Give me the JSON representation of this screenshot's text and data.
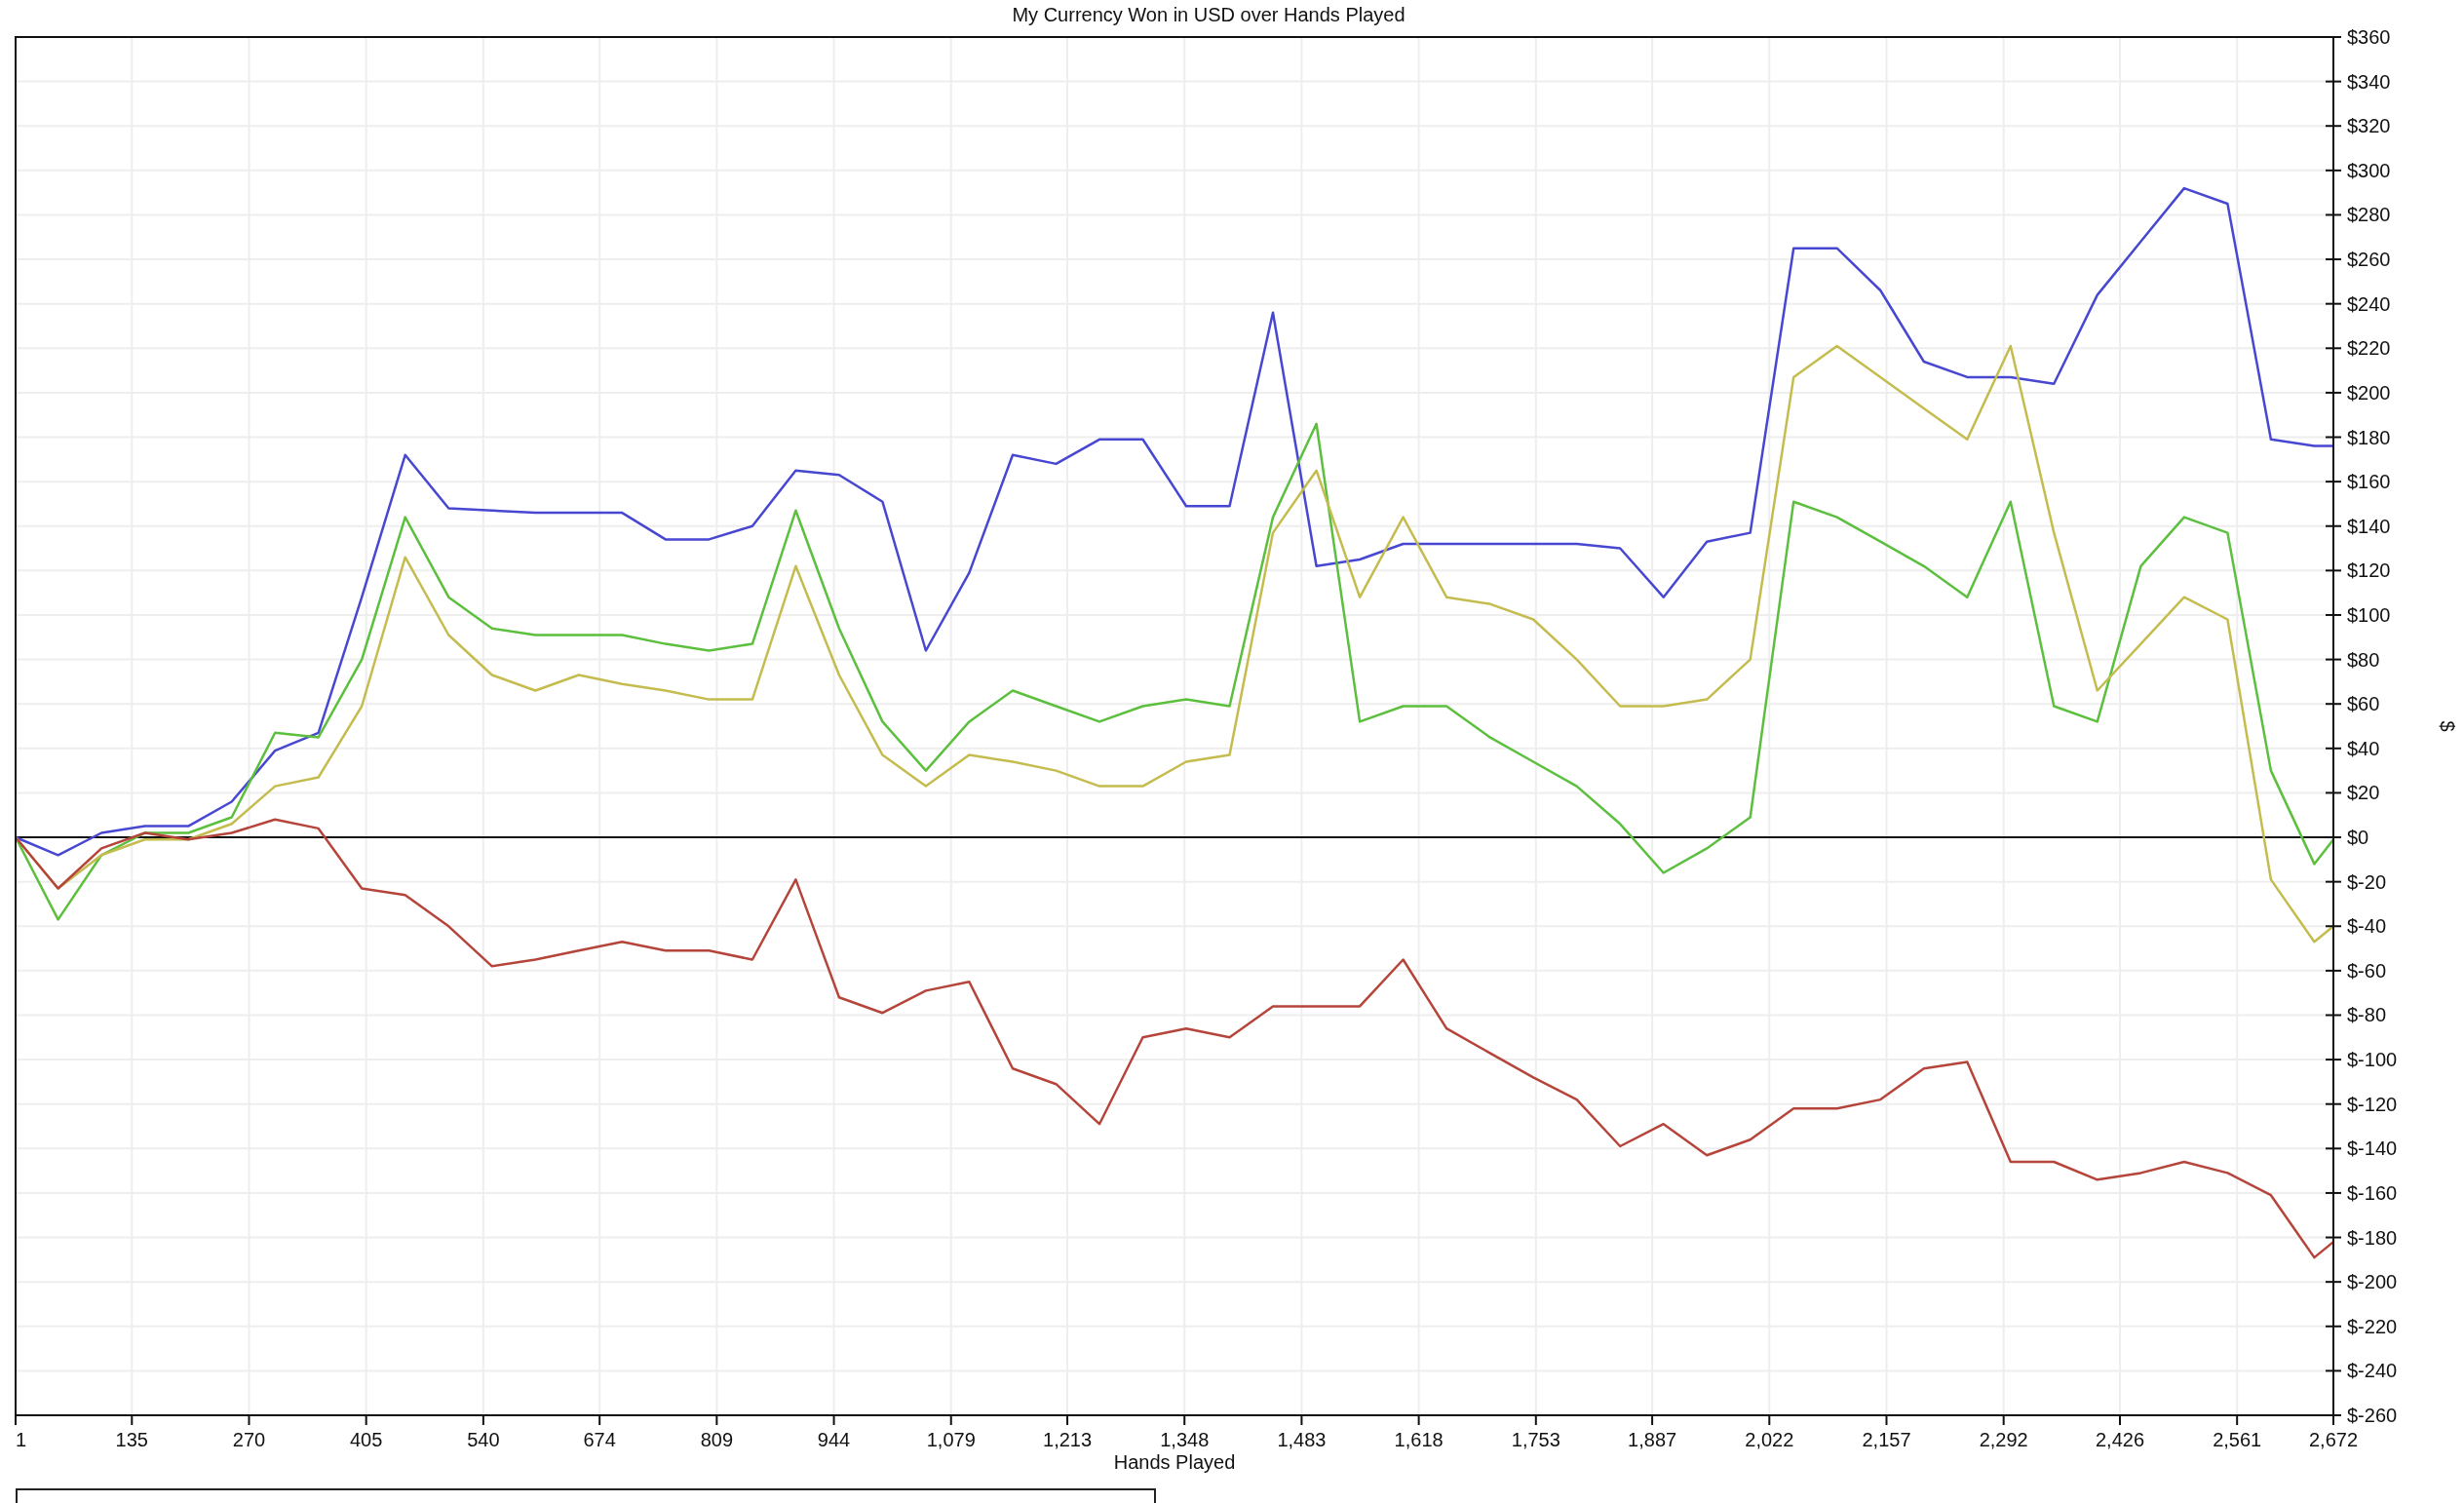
{
  "chart": {
    "chart_data": {
      "type": "line",
      "grid": true,
      "title": "My Currency Won in USD over Hands Played",
      "xlabel": "Hands Played",
      "ylabel": "$",
      "x": [
        1,
        50,
        100,
        150,
        200,
        250,
        300,
        350,
        400,
        450,
        500,
        550,
        600,
        650,
        700,
        750,
        800,
        850,
        900,
        950,
        1000,
        1050,
        1100,
        1150,
        1200,
        1250,
        1300,
        1350,
        1400,
        1450,
        1500,
        1550,
        1600,
        1650,
        1700,
        1750,
        1800,
        1850,
        1900,
        1950,
        2000,
        2050,
        2100,
        2150,
        2200,
        2250,
        2300,
        2350,
        2400,
        2450,
        2500,
        2550,
        2600,
        2650,
        2672
      ],
      "series": [
        {
          "color": "#4747d1",
          "values": [
            0,
            -8,
            2,
            5,
            5,
            16,
            39,
            47,
            108,
            172,
            148,
            147,
            146,
            146,
            146,
            134,
            134,
            140,
            165,
            163,
            151,
            84,
            119,
            172,
            168,
            179,
            179,
            149,
            149,
            236,
            122,
            125,
            132,
            132,
            132,
            132,
            132,
            130,
            108,
            133,
            137,
            265,
            265,
            246,
            214,
            207,
            207,
            204,
            244,
            268,
            292,
            285,
            179,
            176,
            176
          ]
        },
        {
          "color": "#5cbf3e",
          "values": [
            0,
            -37,
            -8,
            2,
            2,
            9,
            47,
            45,
            80,
            144,
            108,
            94,
            91,
            91,
            91,
            87,
            84,
            87,
            147,
            94,
            52,
            30,
            52,
            66,
            59,
            52,
            59,
            62,
            59,
            144,
            186,
            52,
            59,
            59,
            45,
            34,
            23,
            6,
            -16,
            -5,
            9,
            151,
            144,
            133,
            122,
            108,
            151,
            59,
            52,
            122,
            144,
            137,
            30,
            -12,
            -1
          ]
        },
        {
          "color": "#c4bc4e",
          "values": [
            0,
            -23,
            -8,
            -1,
            -1,
            6,
            23,
            27,
            59,
            126,
            91,
            73,
            66,
            73,
            69,
            66,
            62,
            62,
            122,
            73,
            37,
            23,
            37,
            34,
            30,
            23,
            23,
            34,
            37,
            137,
            165,
            108,
            144,
            108,
            105,
            98,
            80,
            59,
            59,
            62,
            80,
            207,
            221,
            207,
            193,
            179,
            221,
            137,
            66,
            87,
            108,
            98,
            -19,
            -47,
            -40
          ]
        },
        {
          "color": "#b5453a",
          "values": [
            0,
            -23,
            -5,
            2,
            -1,
            2,
            8,
            4,
            -23,
            -26,
            -40,
            -58,
            -55,
            -51,
            -47,
            -51,
            -51,
            -55,
            -19,
            -72,
            -79,
            -69,
            -65,
            -104,
            -111,
            -129,
            -90,
            -86,
            -90,
            -76,
            -76,
            -76,
            -55,
            -86,
            -97,
            -108,
            -118,
            -139,
            -129,
            -143,
            -136,
            -122,
            -122,
            -118,
            -104,
            -101,
            -146,
            -146,
            -154,
            -151,
            -146,
            -151,
            -161,
            -189,
            -182
          ]
        }
      ],
      "xlim": [
        1,
        2672
      ],
      "ylim": [
        -260,
        360
      ],
      "xticks": [
        {
          "value": 1,
          "label": "1"
        },
        {
          "value": 135,
          "label": "135"
        },
        {
          "value": 270,
          "label": "270"
        },
        {
          "value": 405,
          "label": "405"
        },
        {
          "value": 540,
          "label": "540"
        },
        {
          "value": 674,
          "label": "674"
        },
        {
          "value": 809,
          "label": "809"
        },
        {
          "value": 944,
          "label": "944"
        },
        {
          "value": 1079,
          "label": "1,079"
        },
        {
          "value": 1213,
          "label": "1,213"
        },
        {
          "value": 1348,
          "label": "1,348"
        },
        {
          "value": 1483,
          "label": "1,483"
        },
        {
          "value": 1618,
          "label": "1,618"
        },
        {
          "value": 1753,
          "label": "1,753"
        },
        {
          "value": 1887,
          "label": "1,887"
        },
        {
          "value": 2022,
          "label": "2,022"
        },
        {
          "value": 2157,
          "label": "2,157"
        },
        {
          "value": 2292,
          "label": "2,292"
        },
        {
          "value": 2426,
          "label": "2,426"
        },
        {
          "value": 2561,
          "label": "2,561"
        },
        {
          "value": 2672,
          "label": "2,672"
        }
      ],
      "yticks": [
        {
          "value": 360,
          "label": "$360"
        },
        {
          "value": 340,
          "label": "$340"
        },
        {
          "value": 320,
          "label": "$320"
        },
        {
          "value": 300,
          "label": "$300"
        },
        {
          "value": 280,
          "label": "$280"
        },
        {
          "value": 260,
          "label": "$260"
        },
        {
          "value": 240,
          "label": "$240"
        },
        {
          "value": 220,
          "label": "$220"
        },
        {
          "value": 200,
          "label": "$200"
        },
        {
          "value": 180,
          "label": "$180"
        },
        {
          "value": 160,
          "label": "$160"
        },
        {
          "value": 140,
          "label": "$140"
        },
        {
          "value": 120,
          "label": "$120"
        },
        {
          "value": 100,
          "label": "$100"
        },
        {
          "value": 80,
          "label": "$80"
        },
        {
          "value": 60,
          "label": "$60"
        },
        {
          "value": 40,
          "label": "$40"
        },
        {
          "value": 20,
          "label": "$20"
        },
        {
          "value": 0,
          "label": "$0"
        },
        {
          "value": -20,
          "label": "$-20"
        },
        {
          "value": -40,
          "label": "$-40"
        },
        {
          "value": -60,
          "label": "$-60"
        },
        {
          "value": -80,
          "label": "$-80"
        },
        {
          "value": -100,
          "label": "$-100"
        },
        {
          "value": -120,
          "label": "$-120"
        },
        {
          "value": -140,
          "label": "$-140"
        },
        {
          "value": -160,
          "label": "$-160"
        },
        {
          "value": -180,
          "label": "$-180"
        },
        {
          "value": -200,
          "label": "$-200"
        },
        {
          "value": -220,
          "label": "$-220"
        },
        {
          "value": -240,
          "label": "$-240"
        },
        {
          "value": -260,
          "label": "$-260"
        }
      ]
    }
  }
}
